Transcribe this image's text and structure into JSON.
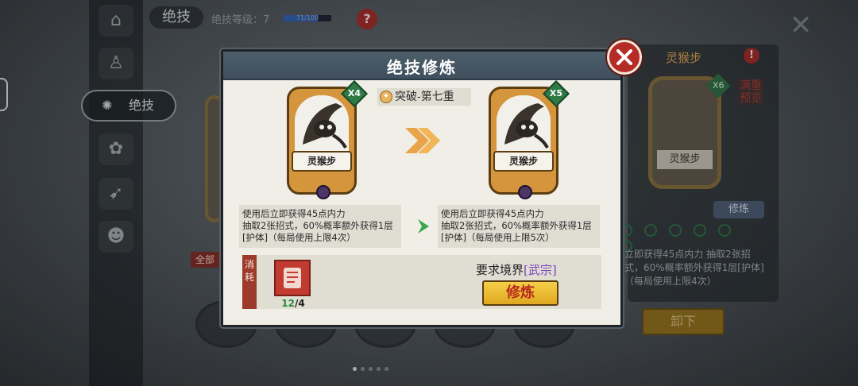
{
  "background": {
    "title": "绝技",
    "level_label": "绝技等级：7",
    "level_bar_text": "71/100",
    "level_progress": 0.71,
    "sidebar_tab_label": "绝技",
    "right_panel": {
      "title": "灵猴步",
      "card_badge": "X6",
      "card_name": "灵猴步",
      "side_label": "满重预览",
      "train_label": "修炼",
      "desc": "立即获得45点内力 抽取2张招式，60%概率额外获得1层[护体]（每局使用上限4次）",
      "unload_label": "卸下"
    },
    "full_tag": "全部"
  },
  "modal": {
    "title": "绝技修炼",
    "stage_label": "突破-第七重",
    "current_card": {
      "name": "灵猴步",
      "badge": "X4"
    },
    "next_card": {
      "name": "灵猴步",
      "badge": "X5"
    },
    "current_desc": "使用后立即获得45点内力\n抽取2张招式，60%概率额外获得1层[护体]（每局使用上限4次）",
    "next_desc": "使用后立即获得45点内力\n抽取2张招式，60%概率额外获得1层[护体]（每局使用上限5次）",
    "cost_label": "消耗",
    "item_have": "12",
    "item_need": "/4",
    "requirement_prefix": "要求境界",
    "requirement_realm": "[武宗]",
    "train_button": "修炼"
  },
  "colors": {
    "header": "#4d5e6b",
    "accent_gold": "#e0a821",
    "close_red": "#b52c26",
    "realm_purple": "#7c45b8",
    "badge_green": "#2f7a45"
  }
}
